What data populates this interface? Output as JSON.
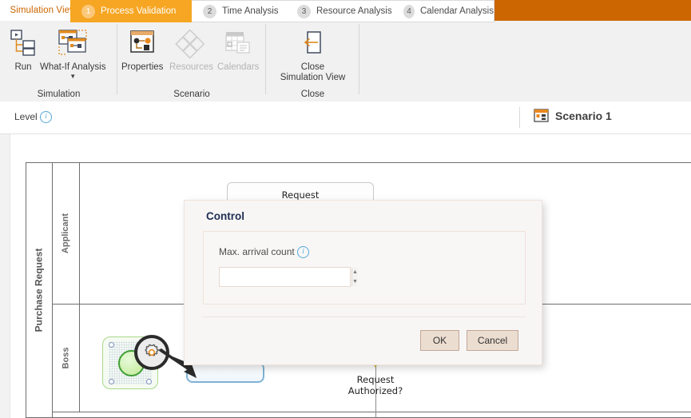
{
  "window": {
    "tab_label": "Simulation View",
    "header_color": "#cc6600",
    "accent_color": "#e08a1e"
  },
  "ribbon": {
    "groups": [
      {
        "name": "Simulation",
        "label": "Simulation",
        "buttons": [
          {
            "label": "Run",
            "icon": "run-flowchart-icon",
            "enabled": true,
            "has_caret": false
          },
          {
            "label": "What-If Analysis",
            "icon": "what-if-windows-icon",
            "enabled": true,
            "has_caret": true
          }
        ]
      },
      {
        "name": "Scenario",
        "label": "Scenario",
        "buttons": [
          {
            "label": "Properties",
            "icon": "properties-panel-icon",
            "enabled": true,
            "has_caret": false
          },
          {
            "label": "Resources",
            "icon": "resources-diamonds-icon",
            "enabled": false,
            "has_caret": false
          },
          {
            "label": "Calendars",
            "icon": "calendar-grid-icon",
            "enabled": false,
            "has_caret": false
          }
        ]
      },
      {
        "name": "Close",
        "label": "Close",
        "buttons": [
          {
            "label": "Close\nSimulation View",
            "label_line1": "Close",
            "label_line2": "Simulation View",
            "icon": "close-arrow-panel-icon",
            "enabled": true,
            "has_caret": false
          }
        ]
      }
    ]
  },
  "stepbar": {
    "level_label": "Level",
    "level_info_icon": "info-icon",
    "steps": [
      {
        "number": "1",
        "label": "Process Validation",
        "active": true
      },
      {
        "number": "2",
        "label": "Time Analysis",
        "active": false
      },
      {
        "number": "3",
        "label": "Resource Analysis",
        "active": false
      },
      {
        "number": "4",
        "label": "Calendar Analysis",
        "active": false
      }
    ],
    "scenario": {
      "label": "Scenario 1",
      "icon": "scenario-window-icon"
    },
    "active_color": "#f6a623"
  },
  "diagram": {
    "pool_label": "Purchase Request",
    "lanes": [
      {
        "label": "Applicant"
      },
      {
        "label": "Boss"
      }
    ],
    "start_event": {
      "name": "start-event",
      "selected": true,
      "color": "#3f9d35"
    },
    "gear_badge_icon": "gear-icon",
    "tasks": [
      {
        "label": "Request"
      }
    ],
    "gateway_label_line1": "Request",
    "gateway_label_line2": "Authorized?"
  },
  "dialog": {
    "title": "Control",
    "field_label": "Max. arrival count",
    "field_info_icon": "info-icon",
    "field_value": "",
    "field_placeholder": "",
    "spinner_up_icon": "spinner-up-icon",
    "spinner_down_icon": "spinner-down-icon",
    "ok_label": "OK",
    "cancel_label": "Cancel"
  }
}
